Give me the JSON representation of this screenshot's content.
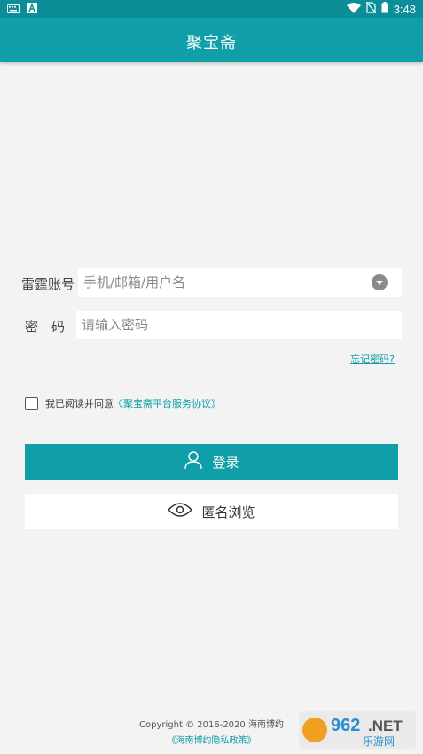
{
  "status_bar": {
    "time": "3:48",
    "left_icons": [
      "keyboard-icon",
      "a-notification-icon"
    ],
    "right_icons": [
      "wifi-icon",
      "no-sim-icon",
      "battery-icon"
    ]
  },
  "app_bar": {
    "title": "聚宝斋"
  },
  "login_form": {
    "account_label": "雷霆账号",
    "account_placeholder": "手机/邮箱/用户名",
    "password_label": "密　码",
    "password_placeholder": "请输入密码",
    "forgot_password": "忘记密码?"
  },
  "agreement": {
    "checked": false,
    "text": "我已阅读并同意",
    "link": "《聚宝斋平台服务协议》"
  },
  "buttons": {
    "login_label": "登录",
    "anonymous_label": "匿名浏览"
  },
  "footer": {
    "copyright": "Copyright © 2016-2020 海南博约",
    "privacy_link": "《海南博约隐私政策》"
  },
  "watermark": {
    "number": "962",
    "tld": ".NET",
    "caption": "乐游网"
  },
  "colors": {
    "status_bar": "#0c8e98",
    "accent": "#109fa8",
    "background": "#f3f3f3"
  }
}
